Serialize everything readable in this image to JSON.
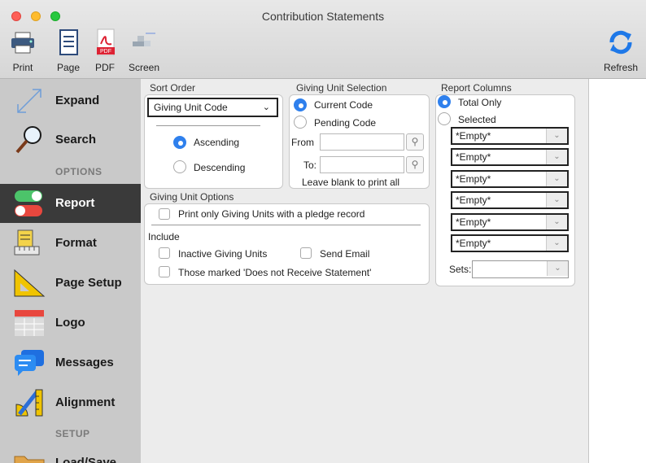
{
  "window": {
    "title": "Contribution Statements"
  },
  "toolbar": {
    "print": "Print",
    "page": "Page",
    "pdf": "PDF",
    "pdf_badge": "PDF",
    "screen": "Screen",
    "refresh": "Refresh"
  },
  "sidebar": {
    "expand": "Expand",
    "search": "Search",
    "options_header": "OPTIONS",
    "report": "Report",
    "format": "Format",
    "page_setup": "Page Setup",
    "logo": "Logo",
    "messages": "Messages",
    "alignment": "Alignment",
    "setup_header": "SETUP",
    "load_save": "Load/Save"
  },
  "sort_order": {
    "label": "Sort Order",
    "selected": "Giving Unit Code",
    "ascending": "Ascending",
    "descending": "Descending",
    "selected_direction": "Ascending"
  },
  "giving_unit_selection": {
    "label": "Giving Unit Selection",
    "current_code": "Current Code",
    "pending_code": "Pending Code",
    "from_label": "From",
    "from_value": "",
    "to_label": "To:",
    "to_value": "",
    "hint": "Leave blank to print all"
  },
  "giving_unit_options": {
    "label": "Giving Unit Options",
    "pledge_only": "Print only Giving Units with a pledge record",
    "include_label": "Include",
    "inactive": "Inactive Giving Units",
    "send_email": "Send Email",
    "not_receive": "Those marked 'Does not Receive Statement'"
  },
  "report_columns": {
    "label": "Report Columns",
    "total_only": "Total Only",
    "selected": "Selected",
    "columns": [
      "*Empty*",
      "*Empty*",
      "*Empty*",
      "*Empty*",
      "*Empty*",
      "*Empty*"
    ],
    "sets_label": "Sets:",
    "sets_value": ""
  },
  "colors": {
    "accent": "#2f80ed",
    "sidebar": "#c9c9c9",
    "active_item": "#3a3a3a"
  }
}
